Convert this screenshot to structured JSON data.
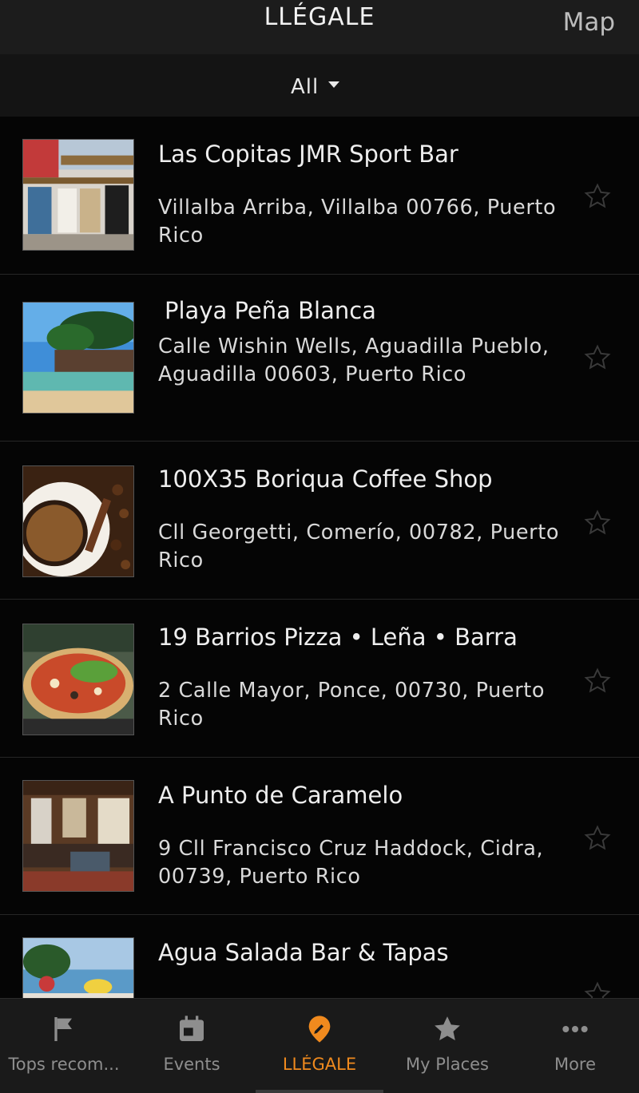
{
  "header": {
    "title": "LLÉGALE",
    "map_label": "Map"
  },
  "filter": {
    "label": "All"
  },
  "places": [
    {
      "name": "Las Copitas JMR Sport Bar",
      "address": "Villalba Arriba, Villalba 00766, Puerto Rico"
    },
    {
      "name": "Playa Peña Blanca",
      "address": "Calle Wishin Wells, Aguadilla Pueblo, Aguadilla 00603, Puerto Rico"
    },
    {
      "name": "100X35 Boriqua Coffee Shop",
      "address": "Cll Georgetti, Comerío, 00782, Puerto Rico"
    },
    {
      "name": "19 Barrios Pizza • Leña • Barra",
      "address": "2 Calle Mayor, Ponce, 00730, Puerto Rico"
    },
    {
      "name": "A Punto de Caramelo",
      "address": "9 Cll Francisco Cruz Haddock, Cidra, 00739, Puerto Rico"
    },
    {
      "name": "Agua Salada Bar & Tapas",
      "address": ""
    }
  ],
  "tabs": [
    {
      "label": "Tops recom...",
      "icon": "flag-icon"
    },
    {
      "label": "Events",
      "icon": "calendar-icon"
    },
    {
      "label": "LLÉGALE",
      "icon": "location-pin-icon"
    },
    {
      "label": "My Places",
      "icon": "star-icon"
    },
    {
      "label": "More",
      "icon": "more-dots-icon"
    }
  ],
  "colors": {
    "accent": "#f08a1e",
    "background": "#050505",
    "header": "#1c1c1c"
  }
}
